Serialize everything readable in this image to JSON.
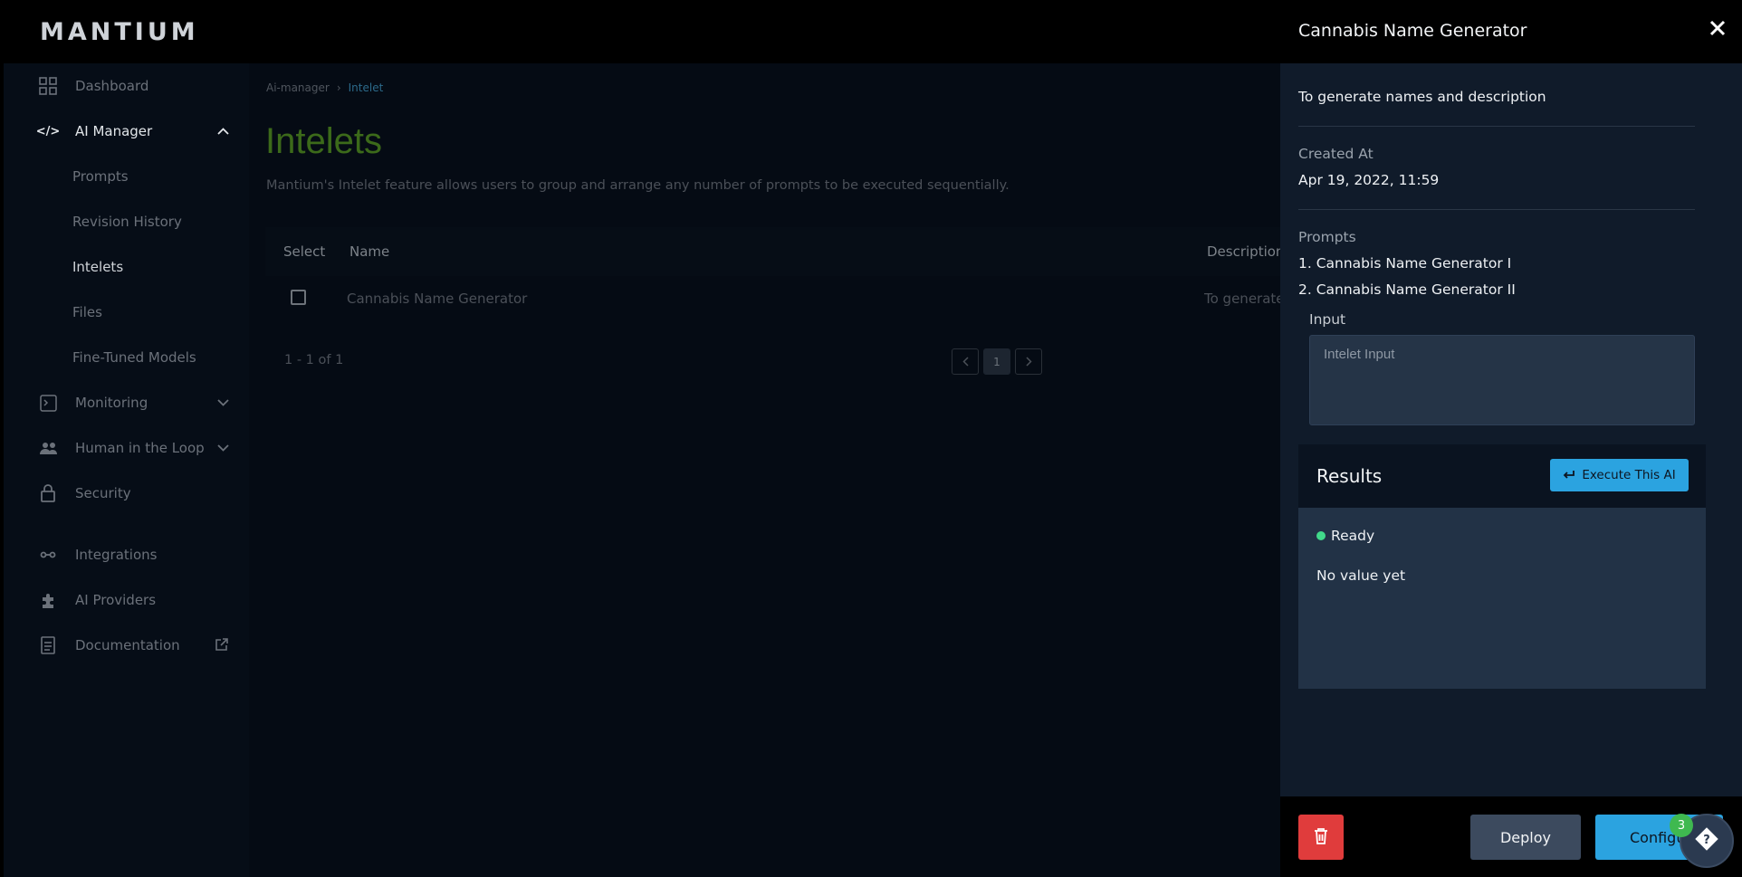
{
  "app": {
    "logo": "MANTIUM"
  },
  "sidebar": {
    "items": [
      {
        "label": "Dashboard",
        "icon": "grid-icon"
      },
      {
        "label": "AI Manager",
        "icon": "code-icon"
      },
      {
        "label": "Monitoring",
        "icon": "terminal-icon"
      },
      {
        "label": "Human in the Loop",
        "icon": "people-icon"
      },
      {
        "label": "Security",
        "icon": "lock-icon"
      },
      {
        "label": "Integrations",
        "icon": "integrations-icon"
      },
      {
        "label": "AI Providers",
        "icon": "puzzle-icon"
      },
      {
        "label": "Documentation",
        "icon": "document-icon"
      }
    ],
    "subitems": [
      {
        "label": "Prompts"
      },
      {
        "label": "Revision History"
      },
      {
        "label": "Intelets"
      },
      {
        "label": "Files"
      },
      {
        "label": "Fine-Tuned Models"
      }
    ]
  },
  "main": {
    "breadcrumbs": [
      "Ai-manager",
      "Intelet"
    ],
    "title": "Intelets",
    "description": "Mantium's Intelet feature allows users to group and arrange any number of prompts to be executed sequentially.",
    "table": {
      "columns": [
        "Select",
        "Name",
        "Description"
      ],
      "rows": [
        {
          "name": "Cannabis Name Generator",
          "description": "To generate na"
        }
      ]
    },
    "pagination": {
      "summary": "1 - 1 of 1",
      "current_page": "1"
    }
  },
  "drawer": {
    "title": "Cannabis Name Generator",
    "description": "To generate names and description",
    "created_label": "Created At",
    "created_value": "Apr 19, 2022, 11:59",
    "prompts_label": "Prompts",
    "prompts": [
      "1. Cannabis Name Generator I",
      "2. Cannabis Name Generator II"
    ],
    "input_label": "Input",
    "input_placeholder": "Intelet Input",
    "input_value": "",
    "results_title": "Results",
    "execute_label": "Execute This AI",
    "status": "Ready",
    "result_value": "No value yet",
    "deploy_label": "Deploy",
    "configure_label": "Configure",
    "help_badge": "3"
  },
  "colors": {
    "accent_blue": "#2ba3e0",
    "danger_red": "#e03c3c",
    "ready_green": "#41d98a",
    "title_green": "#3c6a1a"
  }
}
